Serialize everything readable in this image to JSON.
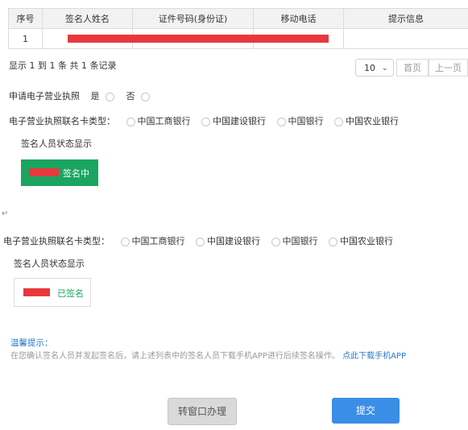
{
  "table": {
    "headers": [
      "序号",
      "签名人姓名",
      "证件号码(身份证)",
      "移动电话",
      "提示信息"
    ],
    "rows": [
      [
        "1",
        "",
        "",
        "",
        ""
      ]
    ]
  },
  "pagination": {
    "summary": "显示 1 到 1 条 共 1 条记录",
    "page_size": "10",
    "first": "首页",
    "prev": "上一页"
  },
  "apply_license": {
    "label": "申请电子营业执照",
    "yes": "是",
    "no": "否"
  },
  "bank_type_1": {
    "label": "电子营业执照联名卡类型：",
    "options": [
      "中国工商银行",
      "中国建设银行",
      "中国银行",
      "中国农业银行"
    ]
  },
  "signer_status_title_1": "签名人员状态显示",
  "signing_badge": "签名中",
  "paragraph_mark": "↵",
  "bank_type_2": {
    "label": "电子营业执照联名卡类型：",
    "options": [
      "中国工商银行",
      "中国建设银行",
      "中国银行",
      "中国农业银行"
    ]
  },
  "signer_status_title_2": "签名人员状态显示",
  "signed_badge": "已签名",
  "tips": {
    "title": "温馨提示：",
    "text": "在您确认签名人员并发起签名后，请上述列表中的签名人员下载手机APP进行后续签名操作。",
    "link": "点此下载手机APP"
  },
  "buttons": {
    "window": "转窗口办理",
    "submit": "提交"
  },
  "colors": {
    "green": "#1aa561",
    "red": "#e8383d",
    "blue": "#3a8ee6",
    "link": "#2a79c5"
  }
}
